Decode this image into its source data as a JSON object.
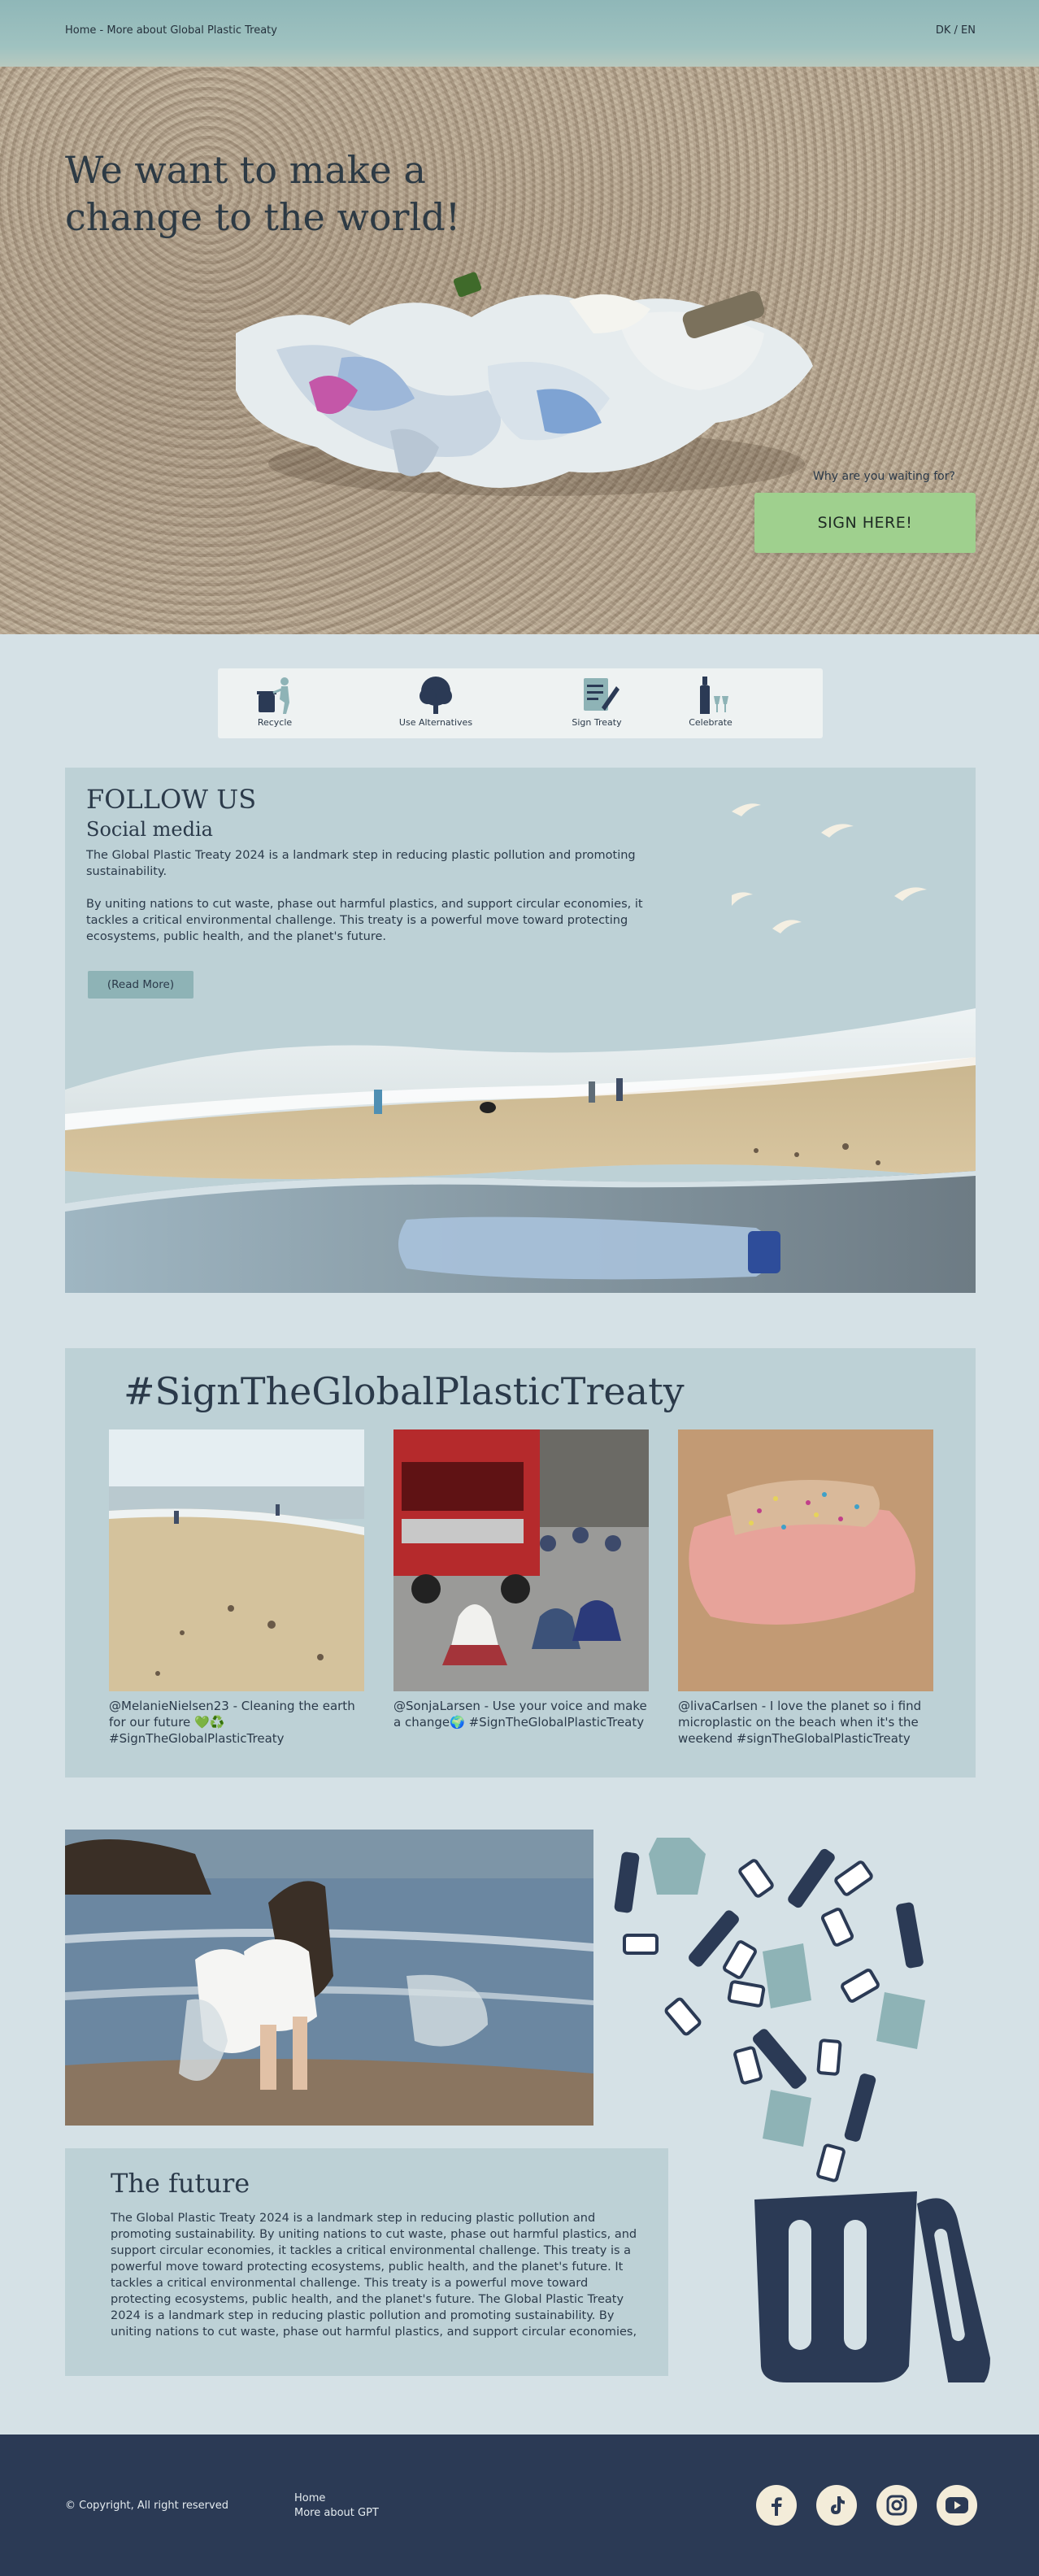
{
  "nav": {
    "breadcrumb": "Home - More about Global Plastic Treaty",
    "lang": "DK / EN"
  },
  "hero": {
    "title": "We want to make a change to the world!",
    "small_text": "Why are you waiting for?",
    "sign_button": "SIGN HERE!"
  },
  "steps": [
    {
      "label": "Recycle",
      "icon": "recycle-person-icon"
    },
    {
      "label": "Use Alternatives",
      "icon": "tree-icon"
    },
    {
      "label": "Sign Treaty",
      "icon": "document-pen-icon"
    },
    {
      "label": "Celebrate",
      "icon": "bottle-glasses-icon"
    }
  ],
  "follow": {
    "title": "FOLLOW US",
    "subtitle": "Social media",
    "paragraph1": "The Global Plastic Treaty 2024 is a landmark step in reducing plastic pollution and promoting sustainability.",
    "paragraph2": "By uniting nations to cut waste, phase out harmful plastics, and support circular economies, it tackles a critical environmental challenge. This treaty is a powerful move toward protecting ecosystems, public health, and the planet's future.",
    "read_more": "(Read More)"
  },
  "hashtag": {
    "title": "#SignTheGlobalPlasticTreaty",
    "cards": [
      {
        "caption": "@MelanieNielsen23 - Cleaning the earth for our future 💚♻️ #SignTheGlobalPlasticTreaty"
      },
      {
        "caption": "@SonjaLarsen - Use your voice and make a change🌍 #SignTheGlobalPlasticTreaty"
      },
      {
        "caption": "@livaCarlsen - I love the planet so i find microplastic on the beach when it's the weekend #signTheGlobalPlasticTreaty"
      }
    ]
  },
  "future": {
    "title": "The future",
    "text": "The Global Plastic Treaty 2024 is a landmark step in reducing plastic pollution and promoting sustainability. By uniting nations to cut waste, phase out harmful plastics, and support circular economies, it tackles a critical environmental challenge. This treaty is a powerful move toward protecting ecosystems, public health, and the planet's future. It tackles a critical environmental challenge. This treaty is a powerful move toward protecting ecosystems, public health, and the planet's future. The Global Plastic Treaty 2024 is a landmark step in reducing plastic pollution and promoting sustainability. By uniting nations to cut waste, phase out harmful plastics, and support circular economies,"
  },
  "footer": {
    "copyright": "© Copyright, All right reserved",
    "links": [
      "Home",
      "More about GPT"
    ],
    "social": [
      "facebook-icon",
      "tiktok-icon",
      "instagram-icon",
      "youtube-icon"
    ]
  },
  "colors": {
    "background": "#d5e1e6",
    "panel": "#bdd1d6",
    "navy": "#2b3a55",
    "sign_green": "#9fd08e",
    "button_teal": "#8eb3b6"
  }
}
